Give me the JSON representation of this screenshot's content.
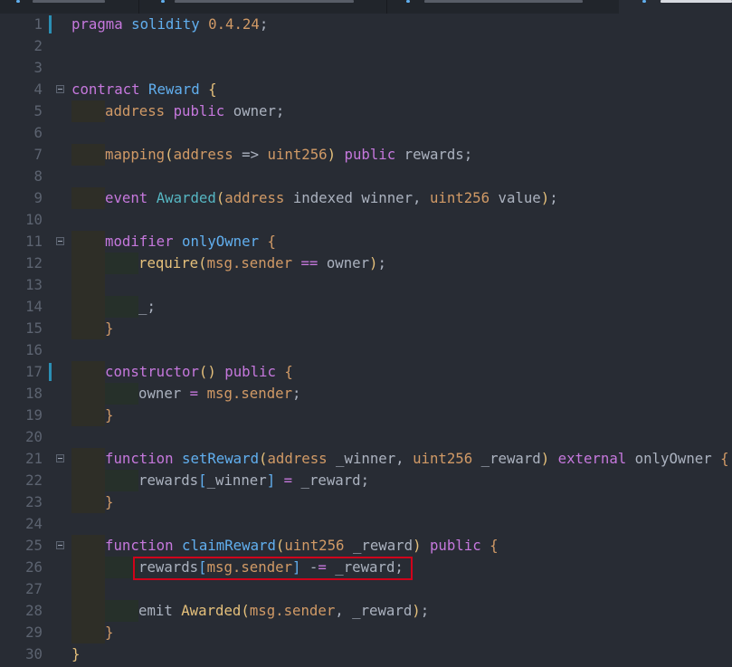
{
  "tabs": [
    {
      "active": false
    },
    {
      "active": false
    },
    {
      "active": false
    },
    {
      "active": true
    }
  ],
  "highlight": {
    "line": 26,
    "color": "#d0021b"
  },
  "lines": [
    {
      "n": "1",
      "mod": true,
      "g": 0,
      "tk": [
        [
          "pragma",
          "k"
        ],
        [
          " ",
          "p"
        ],
        [
          "solidity",
          "f"
        ],
        [
          " ",
          "p"
        ],
        [
          "0.4.24",
          "n"
        ],
        [
          ";",
          "p"
        ]
      ]
    },
    {
      "n": "2",
      "g": 0,
      "tk": []
    },
    {
      "n": "3",
      "g": 0,
      "tk": []
    },
    {
      "n": "4",
      "fold": true,
      "g": 0,
      "tk": [
        [
          "contract",
          "k"
        ],
        [
          " ",
          "p"
        ],
        [
          "Reward",
          "f"
        ],
        [
          " ",
          "p"
        ],
        [
          "{",
          "y"
        ]
      ]
    },
    {
      "n": "5",
      "g": 1,
      "tk": [
        [
          "address",
          "t"
        ],
        [
          " ",
          "p"
        ],
        [
          "public",
          "k"
        ],
        [
          " owner;",
          "p"
        ]
      ]
    },
    {
      "n": "6",
      "g": 0,
      "tk": []
    },
    {
      "n": "7",
      "g": 1,
      "tk": [
        [
          "mapping",
          "t"
        ],
        [
          "(",
          "y"
        ],
        [
          "address",
          "t"
        ],
        [
          " => ",
          "p"
        ],
        [
          "uint256",
          "t"
        ],
        [
          ")",
          "y"
        ],
        [
          " ",
          "p"
        ],
        [
          "public",
          "k"
        ],
        [
          " rewards;",
          "p"
        ]
      ]
    },
    {
      "n": "8",
      "g": 0,
      "tk": []
    },
    {
      "n": "9",
      "g": 1,
      "tk": [
        [
          "event",
          "k"
        ],
        [
          " ",
          "p"
        ],
        [
          "Awarded",
          "e"
        ],
        [
          "(",
          "y"
        ],
        [
          "address",
          "t"
        ],
        [
          " indexed winner, ",
          "p"
        ],
        [
          "uint256",
          "t"
        ],
        [
          " value",
          "p"
        ],
        [
          ")",
          "y"
        ],
        [
          ";",
          "p"
        ]
      ]
    },
    {
      "n": "10",
      "g": 0,
      "tk": []
    },
    {
      "n": "11",
      "fold": true,
      "g": 1,
      "tk": [
        [
          "modifier",
          "k"
        ],
        [
          " ",
          "p"
        ],
        [
          "onlyOwner",
          "f"
        ],
        [
          " ",
          "p"
        ],
        [
          "{",
          "b"
        ]
      ]
    },
    {
      "n": "12",
      "g": 2,
      "tk": [
        [
          "require",
          "y"
        ],
        [
          "(",
          "y"
        ],
        [
          "msg.sender",
          "t"
        ],
        [
          " ",
          "p"
        ],
        [
          "==",
          "o"
        ],
        [
          " owner",
          "p"
        ],
        [
          ")",
          "y"
        ],
        [
          ";",
          "p"
        ]
      ]
    },
    {
      "n": "13",
      "g": 1,
      "tk": []
    },
    {
      "n": "14",
      "g": 2,
      "tk": [
        [
          "_;",
          "p"
        ]
      ]
    },
    {
      "n": "15",
      "g": 1,
      "tk": [
        [
          "}",
          "b"
        ]
      ]
    },
    {
      "n": "16",
      "g": 0,
      "tk": []
    },
    {
      "n": "17",
      "mod": true,
      "g": 1,
      "tk": [
        [
          "constructor",
          "k"
        ],
        [
          "()",
          "y"
        ],
        [
          " ",
          "p"
        ],
        [
          "public",
          "k"
        ],
        [
          " ",
          "p"
        ],
        [
          "{",
          "b"
        ]
      ]
    },
    {
      "n": "18",
      "g": 2,
      "tk": [
        [
          "owner ",
          "p"
        ],
        [
          "=",
          "o"
        ],
        [
          " ",
          "p"
        ],
        [
          "msg.sender",
          "t"
        ],
        [
          ";",
          "p"
        ]
      ]
    },
    {
      "n": "19",
      "g": 1,
      "tk": [
        [
          "}",
          "b"
        ]
      ]
    },
    {
      "n": "20",
      "g": 0,
      "tk": []
    },
    {
      "n": "21",
      "fold": true,
      "g": 1,
      "tk": [
        [
          "function",
          "k"
        ],
        [
          " ",
          "p"
        ],
        [
          "setReward",
          "f"
        ],
        [
          "(",
          "y"
        ],
        [
          "address",
          "t"
        ],
        [
          " _winner, ",
          "p"
        ],
        [
          "uint256",
          "t"
        ],
        [
          " _reward",
          "p"
        ],
        [
          ")",
          "y"
        ],
        [
          " ",
          "p"
        ],
        [
          "external",
          "k"
        ],
        [
          " onlyOwner ",
          "p"
        ],
        [
          "{",
          "b"
        ]
      ]
    },
    {
      "n": "22",
      "g": 2,
      "tk": [
        [
          "rewards",
          "p"
        ],
        [
          "[",
          "s"
        ],
        [
          "_winner",
          "p"
        ],
        [
          "]",
          "s"
        ],
        [
          " ",
          "p"
        ],
        [
          "=",
          "o"
        ],
        [
          " _reward;",
          "p"
        ]
      ]
    },
    {
      "n": "23",
      "g": 1,
      "tk": [
        [
          "}",
          "b"
        ]
      ]
    },
    {
      "n": "24",
      "g": 0,
      "tk": []
    },
    {
      "n": "25",
      "fold": true,
      "g": 1,
      "tk": [
        [
          "function",
          "k"
        ],
        [
          " ",
          "p"
        ],
        [
          "claimReward",
          "f"
        ],
        [
          "(",
          "y"
        ],
        [
          "uint256",
          "t"
        ],
        [
          " _reward",
          "p"
        ],
        [
          ")",
          "y"
        ],
        [
          " ",
          "p"
        ],
        [
          "public",
          "k"
        ],
        [
          " ",
          "p"
        ],
        [
          "{",
          "b"
        ]
      ]
    },
    {
      "n": "26",
      "g": 2,
      "tk": [
        [
          "rewards",
          "p"
        ],
        [
          "[",
          "s"
        ],
        [
          "msg.sender",
          "t"
        ],
        [
          "]",
          "s"
        ],
        [
          " -",
          "p"
        ],
        [
          "=",
          "o"
        ],
        [
          " _reward;",
          "p"
        ]
      ]
    },
    {
      "n": "27",
      "g": 1,
      "tk": []
    },
    {
      "n": "28",
      "g": 2,
      "tk": [
        [
          "emit",
          "p"
        ],
        [
          " ",
          "p"
        ],
        [
          "Awarded",
          "y"
        ],
        [
          "(",
          "y"
        ],
        [
          "msg.sender",
          "t"
        ],
        [
          ", _reward",
          "p"
        ],
        [
          ")",
          "y"
        ],
        [
          ";",
          "p"
        ]
      ]
    },
    {
      "n": "29",
      "g": 1,
      "tk": [
        [
          "}",
          "b"
        ]
      ]
    },
    {
      "n": "30",
      "g": 0,
      "tk": [
        [
          "}",
          "y"
        ]
      ]
    }
  ]
}
